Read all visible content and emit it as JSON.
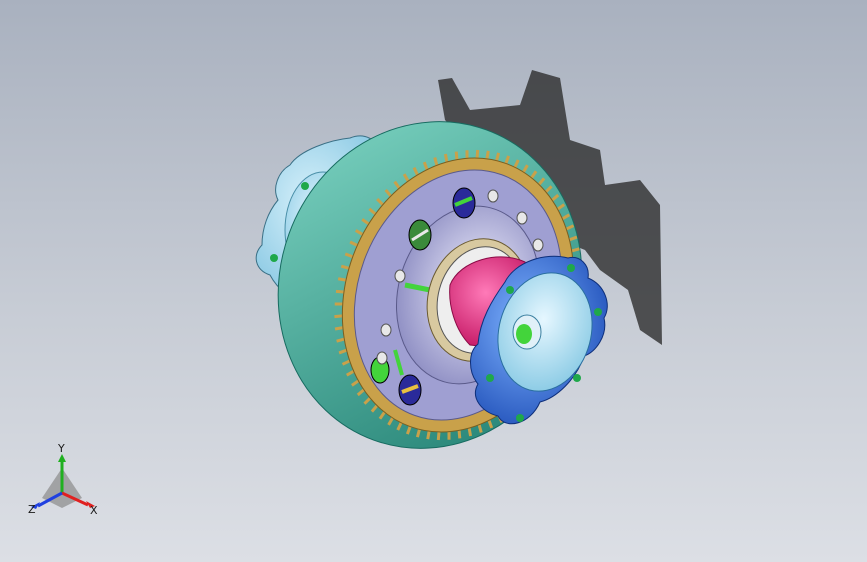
{
  "viewport": {
    "background_top": "#a9b1bf",
    "background_bottom": "#dcdfe5"
  },
  "model": {
    "parts": [
      {
        "name": "gear-ring",
        "color": "#2a9d8f"
      },
      {
        "name": "gear-face",
        "color": "#c9a14a"
      },
      {
        "name": "carrier-housing",
        "color": "#a8a8d8"
      },
      {
        "name": "left-flange",
        "color": "#9fd6ee"
      },
      {
        "name": "right-flange",
        "color": "#2f6fd6"
      },
      {
        "name": "side-gear",
        "color": "#e8237b"
      },
      {
        "name": "bearing",
        "color": "#d8c9a0"
      },
      {
        "name": "pinion-pin",
        "color": "#43d43b"
      }
    ]
  },
  "triad": {
    "x_label": "X",
    "y_label": "Y",
    "z_label": "Z",
    "x_color": "#e02020",
    "y_color": "#20b020",
    "z_color": "#2040e0"
  }
}
